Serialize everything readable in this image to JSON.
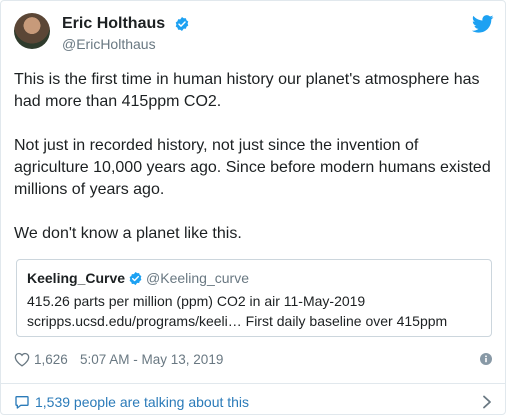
{
  "author": {
    "display_name": "Eric Holthaus",
    "handle": "@EricHolthaus"
  },
  "tweet": {
    "paragraphs": [
      "This is the first time in human history our planet's atmosphere has had more than 415ppm CO2.",
      "Not just in recorded history, not just since the invention of agriculture 10,000 years ago. Since before modern humans existed millions of years ago.",
      "We don't know a planet like this."
    ]
  },
  "quoted": {
    "display_name": "Keeling_Curve",
    "handle": "@Keeling_curve",
    "line1": "415.26 parts per million (ppm) CO2 in air 11-May-2019",
    "line2": "scripps.ucsd.edu/programs/keeli… First daily baseline over 415ppm"
  },
  "meta": {
    "like_count": "1,626",
    "timestamp": "5:07 AM - May 13, 2019"
  },
  "footer": {
    "talking": "1,539 people are talking about this"
  },
  "colors": {
    "twitter_blue": "#1da1f2",
    "link_blue": "#2b7bb9",
    "muted_gray": "#697882"
  },
  "icons": {
    "verified": "verified-badge-icon",
    "bird": "twitter-bird-icon",
    "heart": "heart-icon",
    "info": "info-icon",
    "chat": "chat-bubble-icon",
    "chevron": "chevron-right-icon"
  }
}
